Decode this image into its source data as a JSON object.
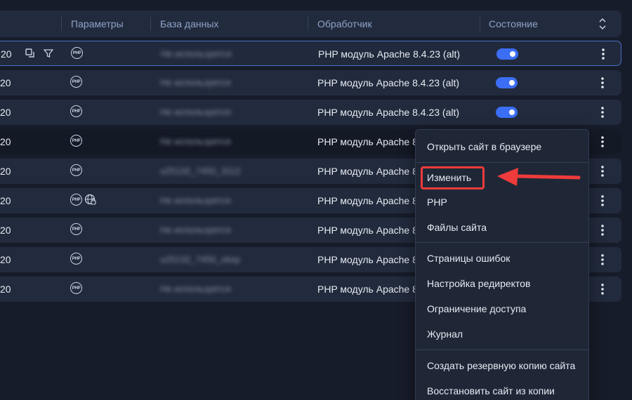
{
  "header": {
    "params": "Параметры",
    "database": "База данных",
    "handler": "Обработчик",
    "status": "Состояние"
  },
  "rows": [
    {
      "num": "20",
      "db": "Не используется",
      "handler": "PHP модуль Apache 8.4.23 (alt)",
      "status": "on"
    },
    {
      "num": "20",
      "db": "Не используется",
      "handler": "PHP модуль Apache 8.4.23 (alt)",
      "status": "on"
    },
    {
      "num": "20",
      "db": "Не используется",
      "handler": "PHP модуль Apache 8.4.23 (alt)",
      "status": "on"
    },
    {
      "num": "20",
      "db": "Не используется",
      "handler": "PHP модуль Apache 8"
    },
    {
      "num": "20",
      "db": "u25132_7450_3112",
      "handler": "PHP модуль Apache 8"
    },
    {
      "num": "20",
      "db": "Не используется",
      "handler": "PHP модуль Apache 8"
    },
    {
      "num": "20",
      "db": "Не используется",
      "handler": "PHP модуль Apache 8"
    },
    {
      "num": "20",
      "db": "u25132_7450_okay",
      "handler": "PHP модуль Apache 8"
    },
    {
      "num": "20",
      "db": "Не используется",
      "handler": "PHP модуль Apache 8"
    }
  ],
  "php_badge": "PHP",
  "menu": {
    "open_in_browser": "Открыть сайт в браузере",
    "edit": "Изменить",
    "php": "PHP",
    "site_files": "Файлы сайта",
    "error_pages": "Страницы ошибок",
    "redirects": "Настройка редиректов",
    "access_limit": "Ограничение доступа",
    "log": "Журнал",
    "create_backup": "Создать резервную копию сайта",
    "restore_backup": "Восстановить сайт из копии"
  },
  "colors": {
    "background": "#171c2a",
    "row": "#222b3d",
    "accent": "#3b6ef5",
    "highlight": "#ee3b3b",
    "header_text": "#8ea2c8"
  },
  "icons": [
    "copy-icon",
    "filter-icon",
    "php-icon",
    "globe-lock-icon",
    "more-vertical-icon",
    "collapse-icon",
    "arrow-left-icon"
  ]
}
